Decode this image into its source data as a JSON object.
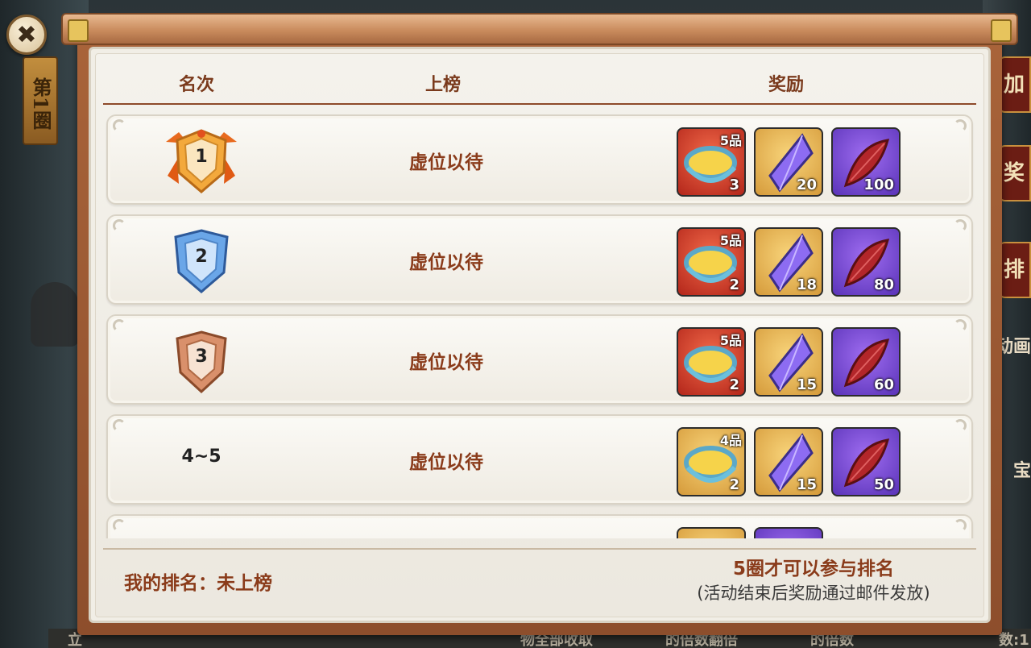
{
  "round_banner": "第1圈",
  "close_icon": "close-icon",
  "side_buttons": [
    "加",
    "奖",
    "排"
  ],
  "side_texts": [
    "动画",
    "宝"
  ],
  "bottom_strip": [
    "立",
    "物全部收取",
    "的倍数翻倍",
    "的倍数",
    "数:1"
  ],
  "header": {
    "rank": "名次",
    "listed": "上榜",
    "reward": "奖励"
  },
  "rows": [
    {
      "rank": "1",
      "medal": "gold-medal-icon",
      "status": "虚位以待",
      "rewards": [
        {
          "icon": "bowl-icon",
          "bg": "red",
          "grade": "5品",
          "count": "3"
        },
        {
          "icon": "crystal-icon",
          "bg": "gold",
          "count": "20"
        },
        {
          "icon": "feather-icon",
          "bg": "purple",
          "count": "100"
        }
      ]
    },
    {
      "rank": "2",
      "medal": "silver-medal-icon",
      "status": "虚位以待",
      "rewards": [
        {
          "icon": "bowl-icon",
          "bg": "red",
          "grade": "5品",
          "count": "2"
        },
        {
          "icon": "crystal-icon",
          "bg": "gold",
          "count": "18"
        },
        {
          "icon": "feather-icon",
          "bg": "purple",
          "count": "80"
        }
      ]
    },
    {
      "rank": "3",
      "medal": "bronze-medal-icon",
      "status": "虚位以待",
      "rewards": [
        {
          "icon": "bowl-icon",
          "bg": "red",
          "grade": "5品",
          "count": "2"
        },
        {
          "icon": "crystal-icon",
          "bg": "gold",
          "count": "15"
        },
        {
          "icon": "feather-icon",
          "bg": "purple",
          "count": "60"
        }
      ]
    },
    {
      "rank": "4~5",
      "status": "虚位以待",
      "rewards": [
        {
          "icon": "bowl-icon",
          "bg": "gold",
          "grade": "4品",
          "count": "2"
        },
        {
          "icon": "crystal-icon",
          "bg": "gold",
          "count": "15"
        },
        {
          "icon": "feather-icon",
          "bg": "purple",
          "count": "50"
        }
      ]
    }
  ],
  "footer": {
    "my_rank": "我的排名：未上榜",
    "note_main": "5圈才可以参与排名",
    "note_sub": "(活动结束后奖励通过邮件发放)"
  },
  "colors": {
    "accent": "#8a3b1a",
    "frame": "#a9643a",
    "panel": "#f1eee6"
  }
}
